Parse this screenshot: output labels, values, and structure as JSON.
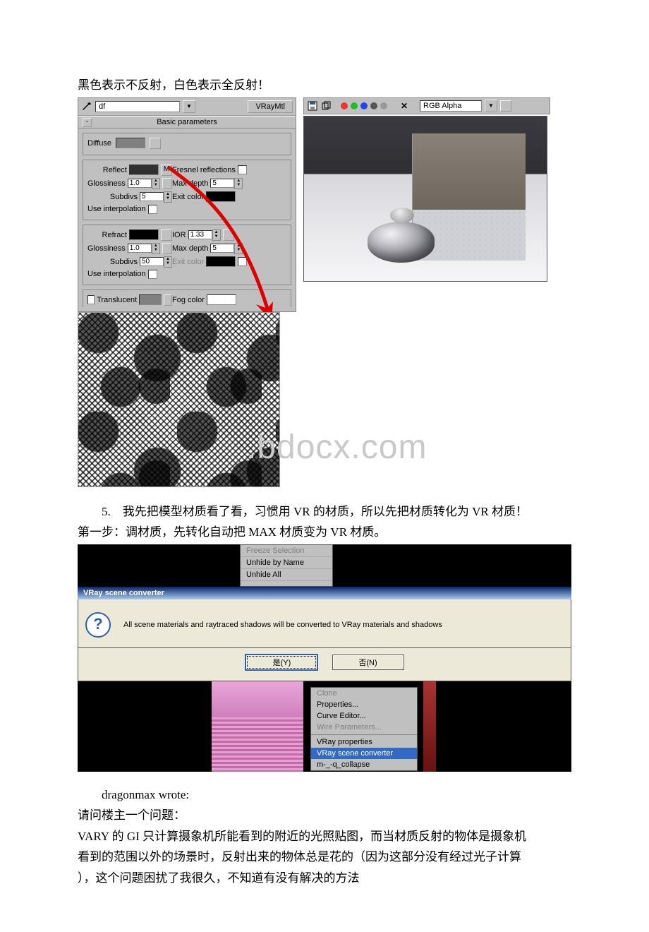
{
  "intro_text": "黑色表示不反射，白色表示全反射！",
  "watermark": ".bdocx.com",
  "material_editor": {
    "name_field": "df",
    "type_button": "VRayMtl",
    "rollout_title": "Basic parameters",
    "labels": {
      "diffuse": "Diffuse",
      "reflect": "Reflect",
      "map_button": "M",
      "fresnel": "Fresnel reflections",
      "glossiness": "Glossiness",
      "max_depth": "Max depth",
      "subdivs": "Subdivs",
      "exit_color": "Exit color",
      "use_interpolation": "Use interpolation",
      "refract": "Refract",
      "ior": "IOR",
      "translucent": "Translucent",
      "fog_color": "Fog color"
    },
    "values": {
      "reflect_glossiness": "1.0",
      "reflect_max_depth": "5",
      "reflect_subdivs": "5",
      "refract_glossiness": "1.0",
      "refract_max_depth": "5",
      "refract_subdivs": "50",
      "ior": "1.33"
    }
  },
  "render_toolbar": {
    "channel_label": "RGB Alpha"
  },
  "para5_line1": "　　5.　我先把模型材质看了看，习惯用 VR 的材质，所以先把材质转化为 VR 材质！",
  "para5_line2": "第一步：调材质，先转化自动把 MAX 材质变为 VR 材质。",
  "context_top": {
    "item0": "Freeze Selection",
    "item1": "Unhide by Name",
    "item2": "Unhide All"
  },
  "dialog": {
    "title": "VRay scene converter",
    "message": "All scene materials and raytraced shadows will be converted to VRay materials and shadows",
    "yes": "是(Y)",
    "no": "否(N)"
  },
  "context_bottom": {
    "clone": "Clone",
    "properties": "Properties...",
    "curve_editor": "Curve Editor...",
    "wire": "Wire Parameters...",
    "vray_props": "VRay properties",
    "vray_conv": "VRay scene converter",
    "collapse": "m-_-q_collapse"
  },
  "quote_author": "　　dragonmax wrote:",
  "q_line1": "请问楼主一个问题：",
  "q_line2": "VARY 的 GI 只计算摄象机所能看到的附近的光照贴图，而当材质反射的物体是摄象机",
  "q_line3": "看到的范围以外的场景时，反射出来的物体总是花的（因为这部分没有经过光子计算",
  "q_line4": "），这个问题困扰了我很久，不知道有没有解决的方法"
}
